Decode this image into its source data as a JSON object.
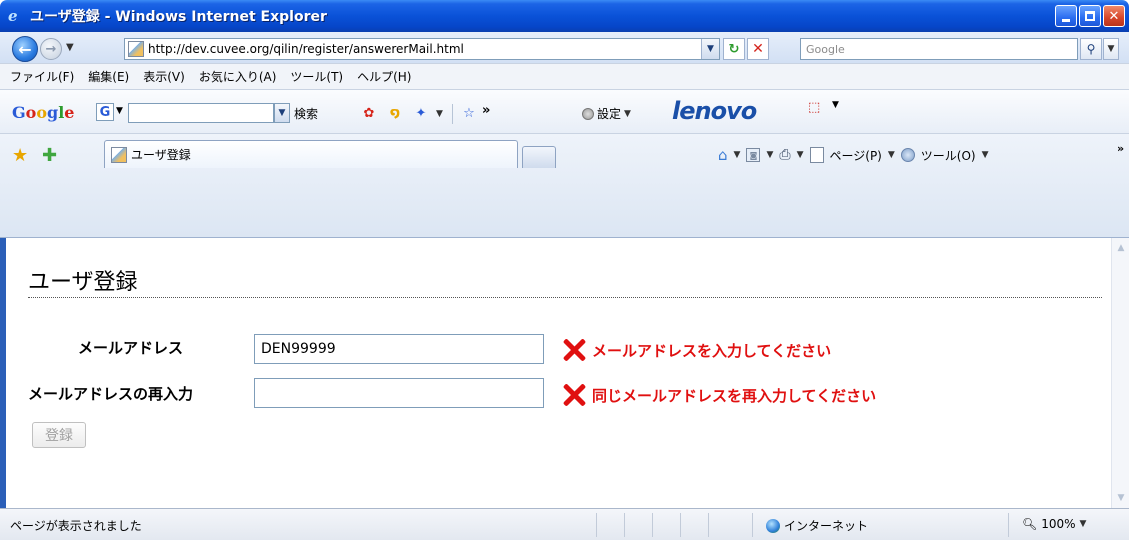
{
  "window": {
    "title": "ユーザ登録 - Windows Internet Explorer"
  },
  "address": {
    "url": "http://dev.cuvee.org/qilin/register/answererMail.html",
    "search_placeholder": "Google"
  },
  "menu": {
    "items": [
      "ファイル(F)",
      "編集(E)",
      "表示(V)",
      "お気に入り(A)",
      "ツール(T)",
      "ヘルプ(H)"
    ]
  },
  "google_toolbar": {
    "search_label": "検索",
    "settings_label": "設定",
    "more": "»",
    "lenovo": "lenovo"
  },
  "tabs": {
    "active_label": "ユーザ登録",
    "cmd_page": "ページ(P)",
    "cmd_tools": "ツール(O)",
    "more": "»"
  },
  "form": {
    "page_title": "ユーザ登録",
    "email_label": "メールアドレス",
    "email_value": "DEN99999",
    "reenter_label": "メールアドレスの再入力",
    "reenter_value": "",
    "email_error": "メールアドレスを入力してください",
    "reenter_error": "同じメールアドレスを再入力してください",
    "submit_label": "登録"
  },
  "status": {
    "text": "ページが表示されました",
    "zone": "インターネット",
    "zoom": "100%"
  },
  "colors": {
    "error": "#e01010",
    "titlebar": "#0a52d8"
  }
}
